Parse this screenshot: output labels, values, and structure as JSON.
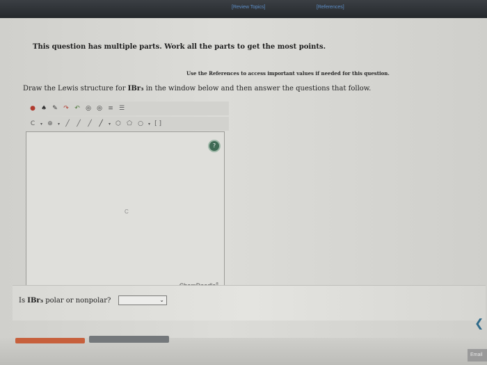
{
  "header": {
    "review_topics": "[Review Topics]",
    "references": "[References]"
  },
  "intro": "This question has multiple parts. Work all the parts to get the most points.",
  "references_note": "Use the References to access important values if needed for this question.",
  "prompt": {
    "before": "Draw the Lewis structure for ",
    "formula": "IBr₃",
    "after": " in the window below and then answer the questions that follow."
  },
  "editor": {
    "toolbar1": [
      {
        "name": "eraser-icon",
        "glyph": "●",
        "tone": "red"
      },
      {
        "name": "move-icon",
        "glyph": "♠",
        "tone": "dark"
      },
      {
        "name": "pencil-icon",
        "glyph": "✎",
        "tone": "dark"
      },
      {
        "name": "redo-icon",
        "glyph": "↷",
        "tone": "red"
      },
      {
        "name": "undo-icon",
        "glyph": "↶",
        "tone": "green"
      },
      {
        "name": "zoom-in-icon",
        "glyph": "◎",
        "tone": "dark"
      },
      {
        "name": "zoom-out-icon",
        "glyph": "◎",
        "tone": "dark"
      },
      {
        "name": "clean-icon",
        "glyph": "≡",
        "tone": ""
      },
      {
        "name": "template-icon",
        "glyph": "☰",
        "tone": ""
      }
    ],
    "toolbar2": [
      {
        "name": "atom-carbon-icon",
        "glyph": "C",
        "tone": ""
      },
      {
        "name": "charge-icon",
        "glyph": "⊕",
        "tone": ""
      },
      {
        "name": "single-bond-icon",
        "glyph": "╱",
        "tone": ""
      },
      {
        "name": "double-bond-icon",
        "glyph": "╱",
        "tone": ""
      },
      {
        "name": "triple-bond-icon",
        "glyph": "╱",
        "tone": ""
      },
      {
        "name": "wedge-bond-icon",
        "glyph": "╱",
        "tone": "dark"
      },
      {
        "name": "ring-hexagon-icon",
        "glyph": "⬡",
        "tone": ""
      },
      {
        "name": "ring-pentagon-icon",
        "glyph": "⬠",
        "tone": ""
      },
      {
        "name": "ring-circle-icon",
        "glyph": "○",
        "tone": ""
      },
      {
        "name": "bracket-icon",
        "glyph": "[ ]",
        "tone": ""
      }
    ],
    "canvas_atom": "C",
    "help_label": "?",
    "brand": "ChemDoodle",
    "brand_mark": "®"
  },
  "question": {
    "text_before": "Is ",
    "formula": "IBr₃",
    "text_after": " polar or nonpolar?",
    "select_value": "",
    "select_chevron": "⌄"
  },
  "footer": {
    "nav_arrow": "❮",
    "email_tab": "Email"
  },
  "colors": {
    "primary_button": "#c7603c",
    "secondary_button": "#74787b",
    "link": "#5d8fc9",
    "help_button": "#3f6b55"
  }
}
